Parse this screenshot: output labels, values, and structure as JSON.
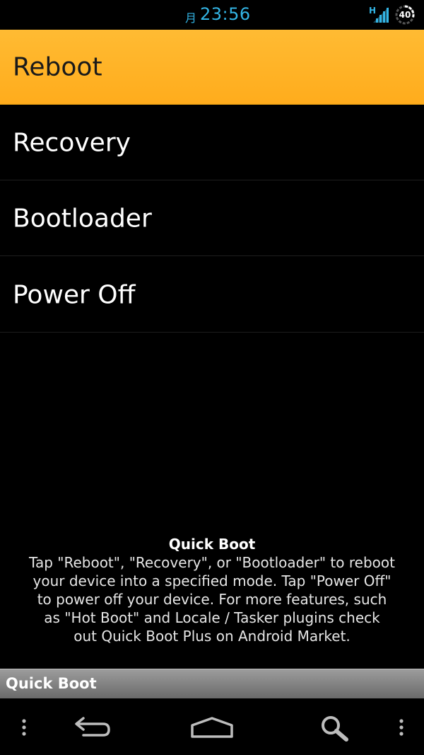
{
  "status_bar": {
    "day": "月",
    "time": "23:56",
    "network": "H",
    "battery_level": "40",
    "accent_color": "#33b5e5"
  },
  "menu": {
    "items": [
      {
        "label": "Reboot",
        "selected": true
      },
      {
        "label": "Recovery",
        "selected": false
      },
      {
        "label": "Bootloader",
        "selected": false
      },
      {
        "label": "Power Off",
        "selected": false
      }
    ],
    "selected_color": "#ffbb33"
  },
  "info": {
    "title": "Quick Boot",
    "lines": [
      "Tap \"Reboot\", \"Recovery\", or \"Bootloader\" to reboot",
      "your device into a specified mode. Tap \"Power Off\"",
      "to power off your device. For more features, such",
      "as \"Hot Boot\" and Locale / Tasker plugins check",
      "out Quick Boot Plus on Android Market."
    ]
  },
  "app_bar": {
    "title": "Quick Boot"
  },
  "nav_bar": {
    "icons": [
      "menu-icon",
      "back-icon",
      "home-icon",
      "search-icon",
      "menu-icon"
    ]
  }
}
